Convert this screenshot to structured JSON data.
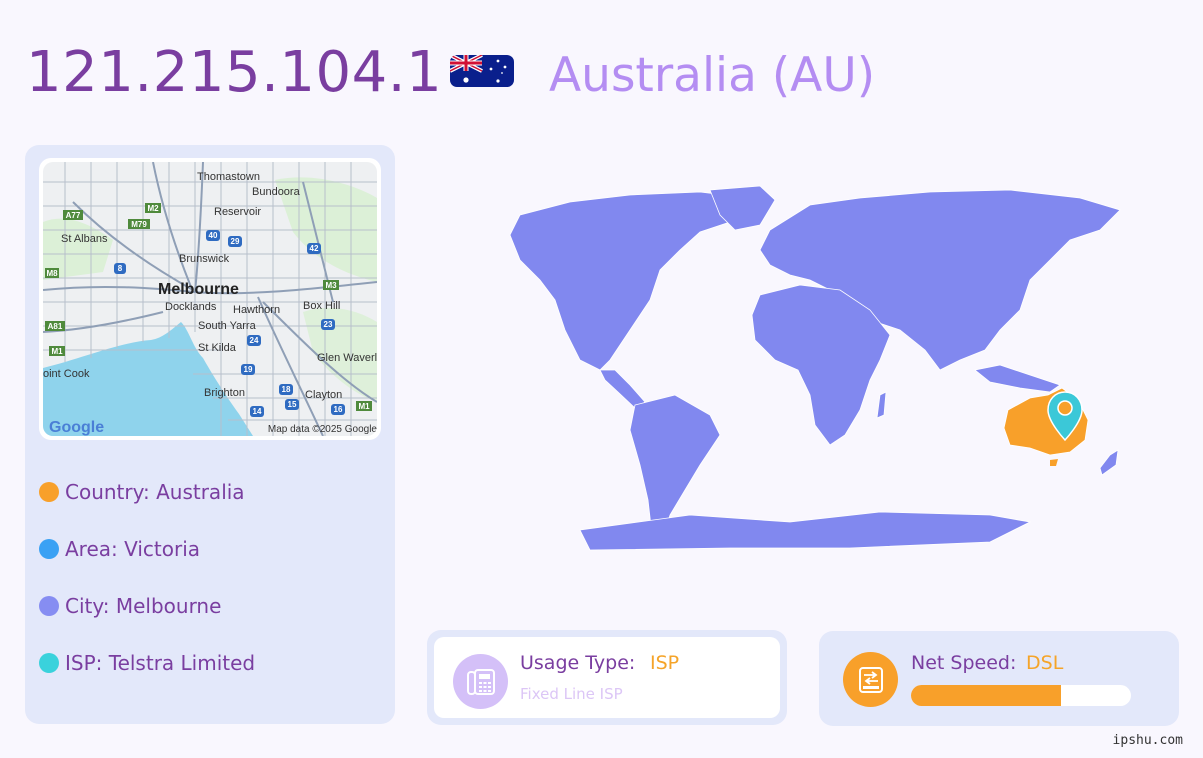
{
  "header": {
    "ip": "121.215.104.1",
    "country": "Australia (AU)",
    "flag_icon": "australia-flag-icon"
  },
  "map": {
    "labels": {
      "thomastown": "Thomastown",
      "bundoora": "Bundoora",
      "reservoir": "Reservoir",
      "st_albans": "St Albans",
      "brunswick": "Brunswick",
      "melbourne": "Melbourne",
      "docklands": "Docklands",
      "hawthorn": "Hawthorn",
      "box_hill": "Box Hill",
      "south_yarra": "South Yarra",
      "st_kilda": "St Kilda",
      "glen_waverley": "Glen Waverl",
      "point_cook": "oint Cook",
      "brighton": "Brighton",
      "clayton": "Clayton",
      "google": "Google",
      "credit": "Map data ©2025 Google"
    },
    "shields": {
      "a77": "A77",
      "m2": "M2",
      "m79": "M79",
      "r40": "40",
      "r29": "29",
      "r42": "42",
      "m8": "M8",
      "r8": "8",
      "m3": "M3",
      "a81": "A81",
      "r23": "23",
      "m1a": "M1",
      "r24": "24",
      "r19": "19",
      "r18": "18",
      "r15": "15",
      "r14": "14",
      "r16": "16",
      "m1b": "M1"
    }
  },
  "info": {
    "country": "Country: Australia",
    "area": "Area: Victoria",
    "city": "City: Melbourne",
    "isp": "ISP: Telstra Limited"
  },
  "usage": {
    "label": "Usage Type:",
    "value": "ISP",
    "sub": "Fixed Line ISP",
    "icon": "phone-icon"
  },
  "speed": {
    "label": "Net Speed:",
    "value": "DSL",
    "progress": 0.68,
    "icon": "router-icon"
  },
  "watermark": "ipshu.com",
  "colors": {
    "primary": "#7a3ea0",
    "accent_orange": "#f8a02a",
    "lavender": "#b48df2",
    "panel_bg": "#e3e8fa",
    "land": "#8188ef",
    "australia": "#f8a02a",
    "pin": "#3bc8d8",
    "dot_country": "#f8a02a",
    "dot_area": "#3aa1f4",
    "dot_city": "#868df2",
    "dot_isp": "#3ad2dc"
  }
}
